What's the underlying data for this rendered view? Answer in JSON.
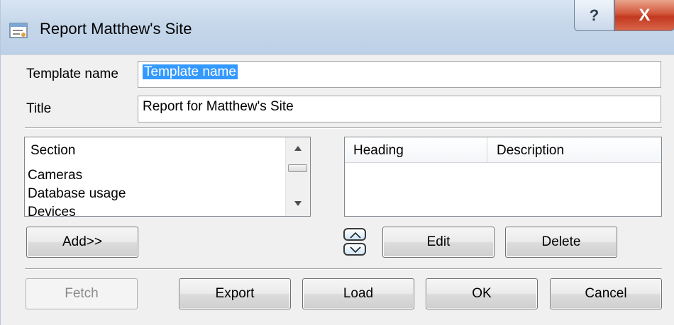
{
  "window": {
    "title": "Report Matthew's Site",
    "help_glyph": "?",
    "close_glyph": "X"
  },
  "form": {
    "template_name_label": "Template name",
    "template_name_value": "Template name",
    "title_label": "Title",
    "title_value": "Report for Matthew's Site"
  },
  "sections_list": {
    "header": "Section",
    "items": [
      "Cameras",
      "Database usage",
      "Devices"
    ]
  },
  "headings_table": {
    "columns": [
      "Heading",
      "Description"
    ],
    "rows": []
  },
  "buttons": {
    "add": "Add>>",
    "edit": "Edit",
    "delete": "Delete",
    "fetch": "Fetch",
    "export": "Export",
    "load": "Load",
    "ok": "OK",
    "cancel": "Cancel"
  },
  "icons": {
    "app": "report-window-icon",
    "move_up": "move-up-icon",
    "move_down": "move-down-icon"
  },
  "colors": {
    "selection": "#3399ff",
    "close_button": "#c2391f"
  }
}
